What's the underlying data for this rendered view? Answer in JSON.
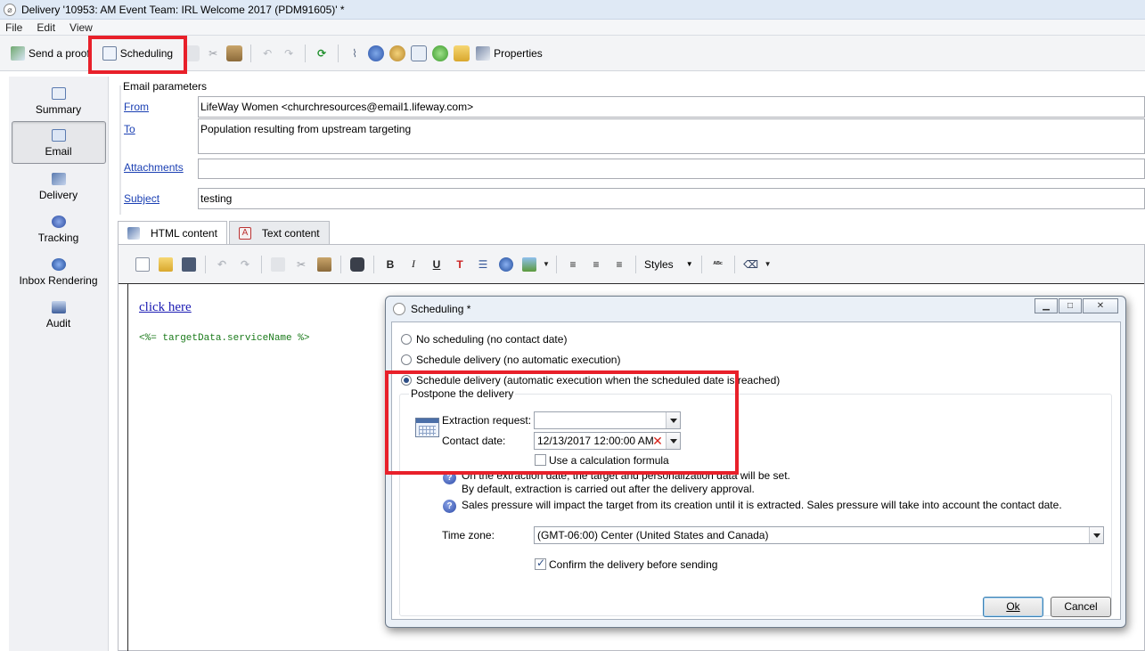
{
  "window": {
    "title": "Delivery '10953: AM Event Team: IRL Welcome 2017 (PDM91605)' *"
  },
  "menu": [
    "File",
    "Edit",
    "View"
  ],
  "toolbar": {
    "send_proof": "Send a proof",
    "scheduling": "Scheduling",
    "properties": "Properties"
  },
  "nav": {
    "items": [
      {
        "label": "Summary",
        "icon": "summary-icon"
      },
      {
        "label": "Email",
        "icon": "email-icon"
      },
      {
        "label": "Delivery",
        "icon": "delivery-icon"
      },
      {
        "label": "Tracking",
        "icon": "tracking-icon"
      },
      {
        "label": "Inbox Rendering",
        "icon": "globe-icon"
      },
      {
        "label": "Audit",
        "icon": "audit-icon"
      }
    ]
  },
  "email_params": {
    "section_title": "Email parameters",
    "from_label": "From",
    "from_value": "LifeWay Women <churchresources@email1.lifeway.com>",
    "to_label": "To",
    "to_value": "Population resulting from upstream targeting",
    "attachments_label": "Attachments",
    "attachments_value": "",
    "subject_label": "Subject",
    "subject_value": "testing"
  },
  "tabs": {
    "html": "HTML content",
    "text": "Text content"
  },
  "editor": {
    "styles": "Styles",
    "bold": "B",
    "italic": "I",
    "underline": "U",
    "link_text": "click here",
    "code_text": "<%= targetData.serviceName %>"
  },
  "dialog": {
    "title": "Scheduling *",
    "options": {
      "none": "No scheduling (no contact date)",
      "manual": "Schedule delivery (no automatic execution)",
      "auto": "Schedule delivery (automatic execution when the scheduled date is reached)"
    },
    "selected": "auto",
    "group_title": "Postpone the delivery",
    "extraction_label": "Extraction request:",
    "extraction_value": "",
    "contact_label": "Contact date:",
    "contact_value": "12/13/2017 12:00:00 AM",
    "formula_label": "Use a calculation formula",
    "info1_line1": "On the extraction date, the target and personalization data will be set.",
    "info1_line2": "By default, extraction is carried out after the delivery approval.",
    "info2": "Sales pressure will impact the target from its creation until it is extracted. Sales pressure will take into account the contact date.",
    "timezone_label": "Time zone:",
    "timezone_value": "(GMT-06:00) Center (United States and Canada)",
    "confirm_label": "Confirm the delivery before sending",
    "confirm_checked": true,
    "ok": "Ok",
    "cancel": "Cancel"
  },
  "colors": {
    "highlight": "#e8202a",
    "link": "#1a3fb3"
  }
}
